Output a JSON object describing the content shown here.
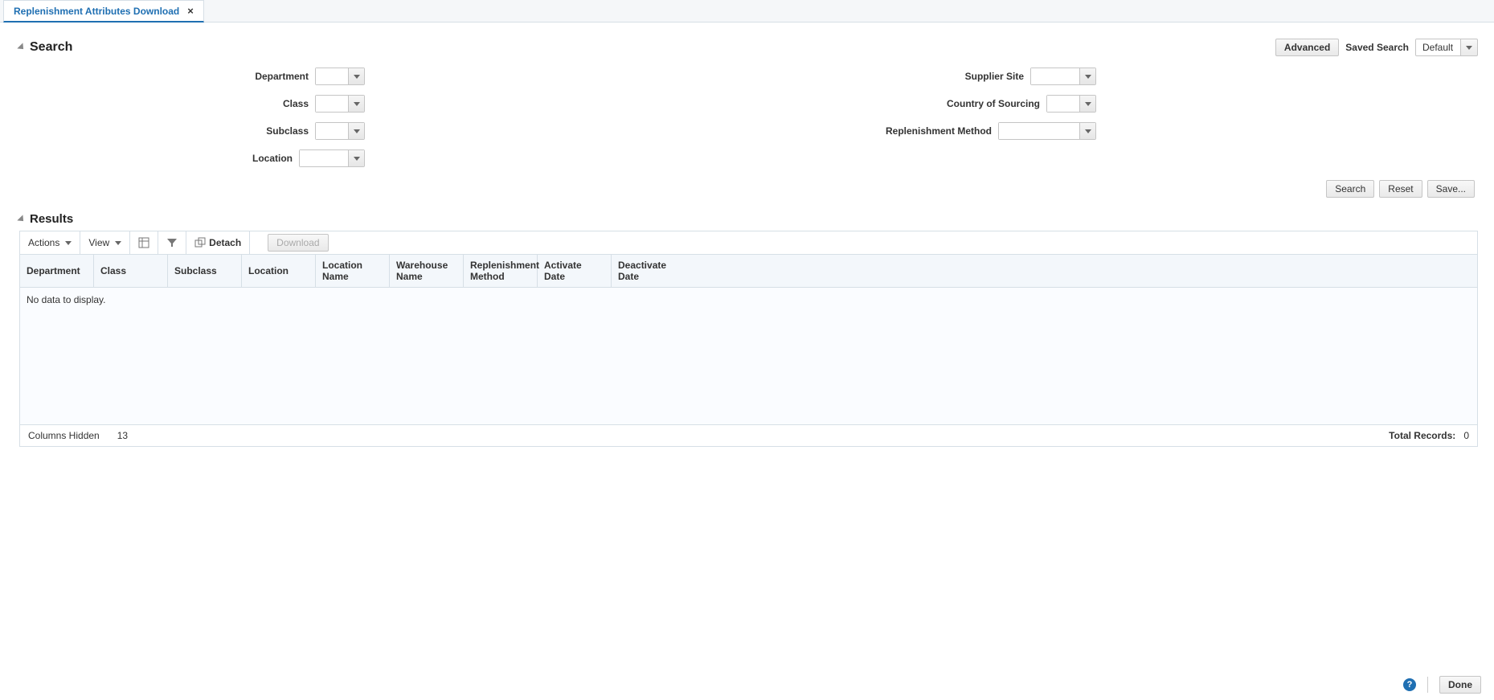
{
  "tab": {
    "title": "Replenishment Attributes Download",
    "close_aria": "Close Tab"
  },
  "search": {
    "title": "Search",
    "advanced_btn": "Advanced",
    "saved_search_label": "Saved Search",
    "saved_search_value": "Default",
    "fields": {
      "department": "Department",
      "class": "Class",
      "subclass": "Subclass",
      "location": "Location",
      "supplier_site": "Supplier Site",
      "country_sourcing": "Country of Sourcing",
      "replenishment_method": "Replenishment Method"
    },
    "actions": {
      "search": "Search",
      "reset": "Reset",
      "save": "Save..."
    }
  },
  "results": {
    "title": "Results",
    "toolbar": {
      "actions": "Actions",
      "view": "View",
      "detach": "Detach",
      "download": "Download"
    },
    "columns": {
      "department": "Department",
      "class": "Class",
      "subclass": "Subclass",
      "location": "Location",
      "location_name": "Location Name",
      "warehouse_name": "Warehouse Name",
      "replenishment_method": "Replenishment Method",
      "activate_date": "Activate Date",
      "deactivate_date": "Deactivate Date"
    },
    "empty_text": "No data to display.",
    "footer": {
      "columns_hidden_label": "Columns Hidden",
      "columns_hidden_value": "13",
      "total_records_label": "Total Records:",
      "total_records_value": "0"
    }
  },
  "page_footer": {
    "done": "Done"
  }
}
